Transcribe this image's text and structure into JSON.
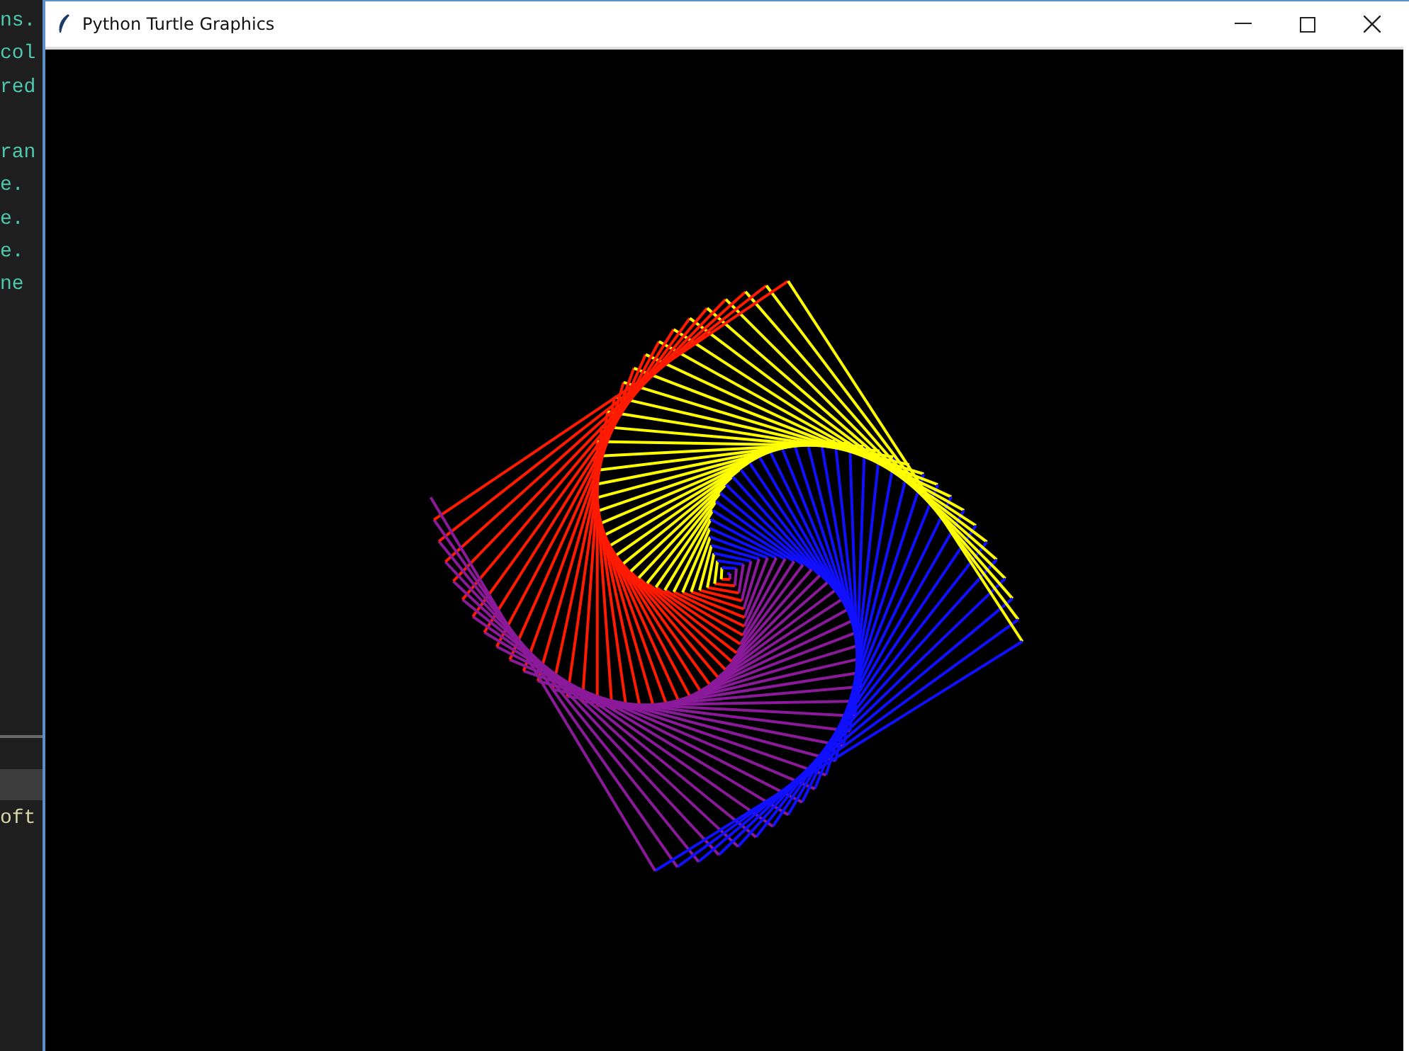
{
  "editor": {
    "blocks": [
      [
        "ns.",
        "col",
        "red"
      ],
      [
        "ran",
        "e.",
        "e.",
        "e.",
        "ne"
      ]
    ],
    "lower_lines": [
      "oft"
    ]
  },
  "window": {
    "title": "Python Turtle Graphics"
  }
}
